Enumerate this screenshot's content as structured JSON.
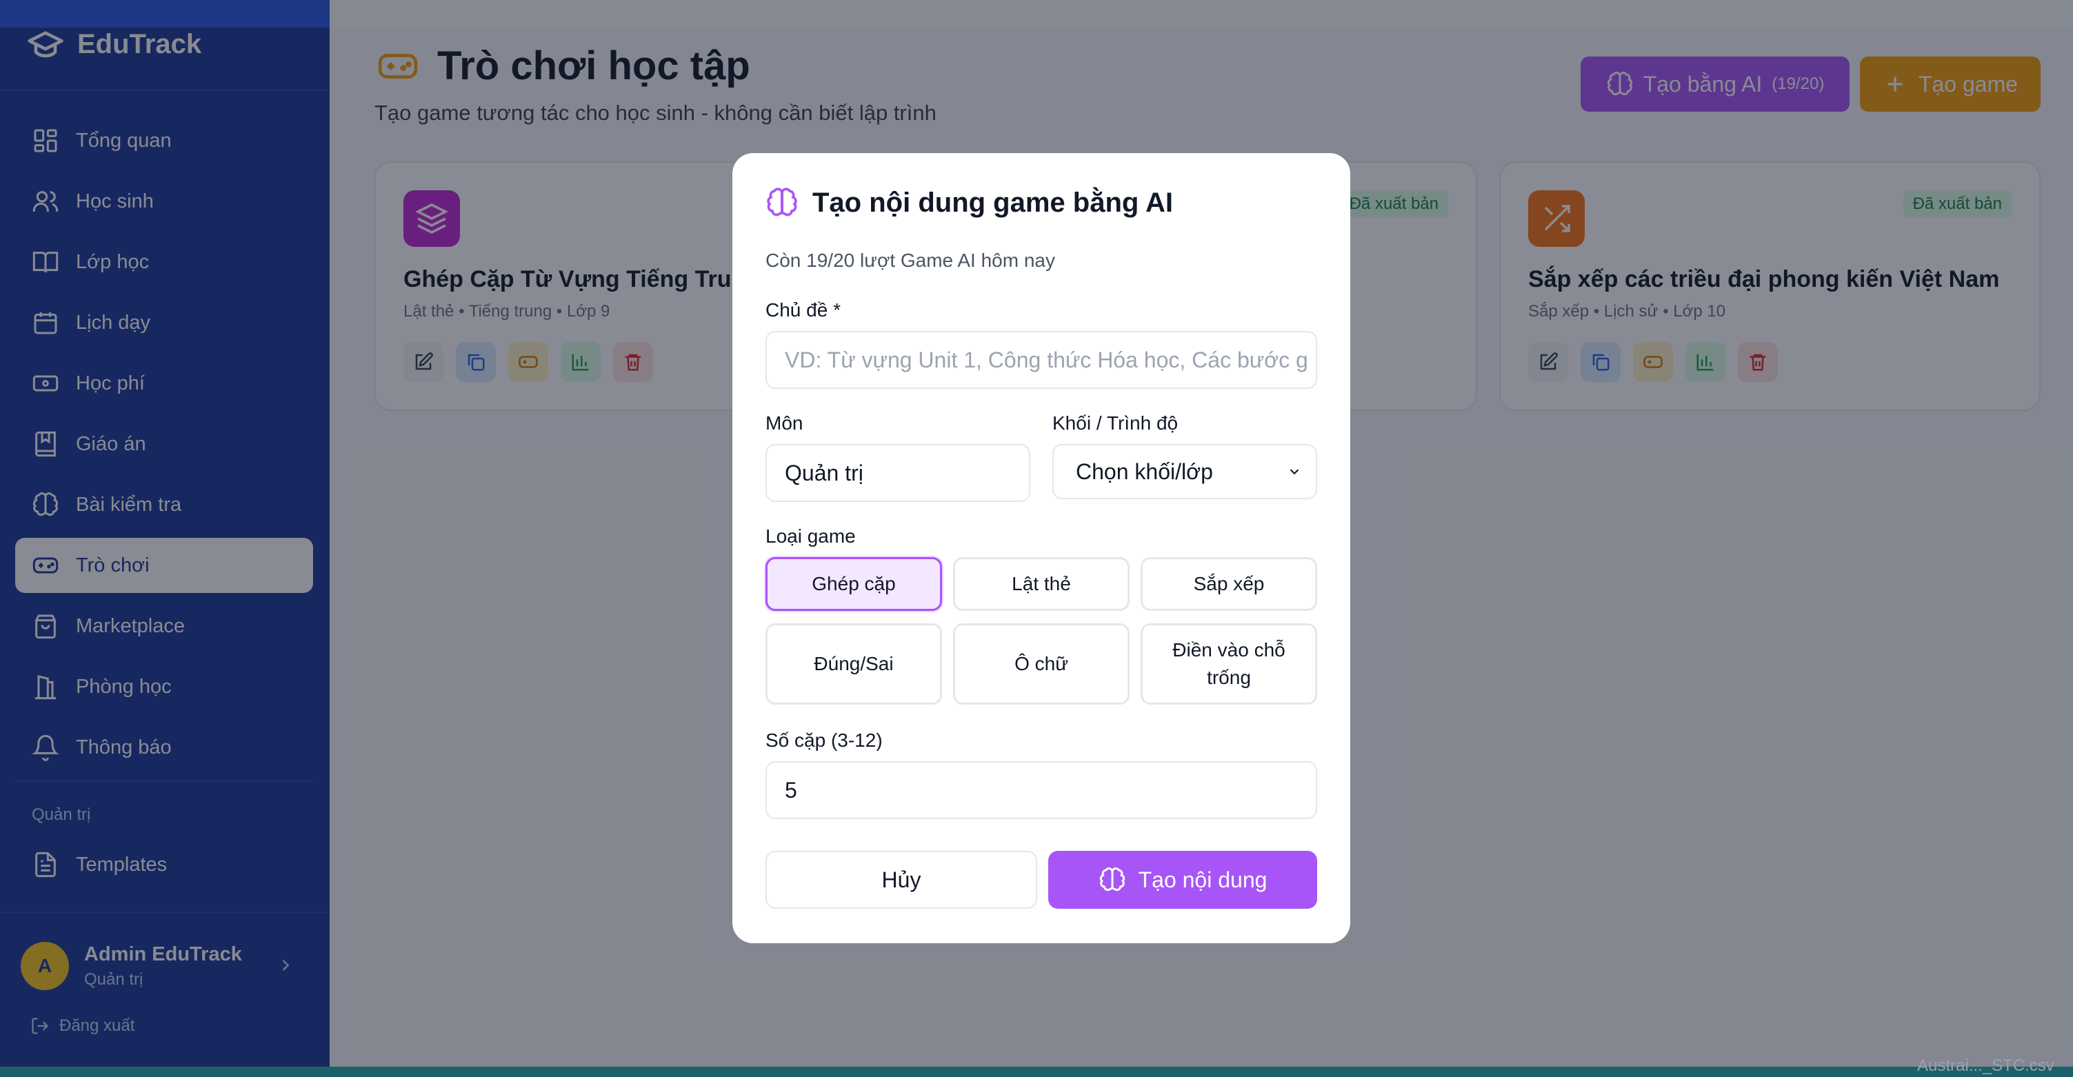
{
  "app": {
    "name": "EduTrack"
  },
  "sidebar": {
    "items": [
      {
        "label": "Tổng quan",
        "icon": "dashboard-icon"
      },
      {
        "label": "Học sinh",
        "icon": "users-icon"
      },
      {
        "label": "Lớp học",
        "icon": "book-open-icon"
      },
      {
        "label": "Lịch dạy",
        "icon": "calendar-icon"
      },
      {
        "label": "Học phí",
        "icon": "banknote-icon"
      },
      {
        "label": "Giáo án",
        "icon": "notebook-icon"
      },
      {
        "label": "Bài kiểm tra",
        "icon": "brain-icon"
      },
      {
        "label": "Trò chơi",
        "icon": "gamepad-icon",
        "active": true
      },
      {
        "label": "Marketplace",
        "icon": "shopping-bag-icon"
      },
      {
        "label": "Phòng học",
        "icon": "building-icon"
      },
      {
        "label": "Thông báo",
        "icon": "bell-icon"
      }
    ],
    "section_label": "Quản trị",
    "admin_items": [
      {
        "label": "Templates",
        "icon": "file-text-icon"
      }
    ],
    "user": {
      "initial": "A",
      "name": "Admin EduTrack",
      "role": "Quản trị"
    },
    "logout_label": "Đăng xuất"
  },
  "page": {
    "title": "Trò chơi học tập",
    "subtitle": "Tạo game tương tác cho học sinh - không cần biết lập trình",
    "ai_button": {
      "label": "Tạo bằng AI",
      "count": "(19/20)"
    },
    "create_button": {
      "label": "Tạo game"
    }
  },
  "cards": [
    {
      "title": "Ghép Cặp Từ Vựng Tiếng Trung",
      "meta": "Lật thẻ • Tiếng trung • Lớp 9",
      "icon": "layers-icon",
      "color": "#c026d3",
      "badge": ""
    },
    {
      "title": "",
      "meta": "",
      "icon": "",
      "color": "",
      "badge": "Đã xuất bản"
    },
    {
      "title": "Sắp xếp các triều đại phong kiến Việt Nam",
      "meta": "Sắp xếp • Lịch sử • Lớp 10",
      "icon": "shuffle-icon",
      "color": "#f97316",
      "badge": "Đã xuất bản"
    }
  ],
  "modal": {
    "title": "Tạo nội dung game bằng AI",
    "remaining": "Còn 19/20 lượt Game AI hôm nay",
    "topic_label": "Chủ đề *",
    "topic_placeholder": "VD: Từ vựng Unit 1, Công thức Hóa học, Các bước g",
    "subject_label": "Môn",
    "subject_value": "Quản trị",
    "level_label": "Khối / Trình độ",
    "level_value": "Chọn khối/lớp",
    "game_type_label": "Loại game",
    "game_types": [
      "Ghép cặp",
      "Lật thẻ",
      "Sắp xếp",
      "Đúng/Sai",
      "Ô chữ",
      "Điền vào chỗ trống"
    ],
    "selected_game_type": "Ghép cặp",
    "pairs_label": "Số cặp (3-12)",
    "pairs_value": "5",
    "cancel_label": "Hủy",
    "submit_label": "Tạo nội dung"
  },
  "colors": {
    "sidebar": "#1c3898",
    "accent_purple": "#a855f7",
    "accent_orange": "#f59e0b"
  },
  "corner_text": "Austrai..._STC.csv"
}
